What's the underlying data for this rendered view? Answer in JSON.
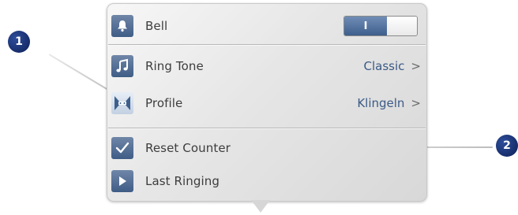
{
  "callouts": [
    {
      "number": "1"
    },
    {
      "number": "2"
    }
  ],
  "menu": {
    "bell": {
      "label": "Bell",
      "toggle_state": "I",
      "enabled": true,
      "icon": "bell-icon"
    },
    "ring_tone": {
      "label": "Ring Tone",
      "value": "Classic",
      "chevron": ">",
      "icon": "music-note-icon"
    },
    "profile": {
      "label": "Profile",
      "value": "Klingeln",
      "chevron": ">",
      "icon": "profile-icon"
    },
    "reset_counter": {
      "label": "Reset Counter",
      "icon": "checkmark-icon"
    },
    "last_ringing": {
      "label": "Last Ringing",
      "icon": "play-icon"
    }
  },
  "colors": {
    "icon_blue": "#4a6690",
    "value_blue": "#3b5a86",
    "badge_navy": "#0d1f57"
  }
}
